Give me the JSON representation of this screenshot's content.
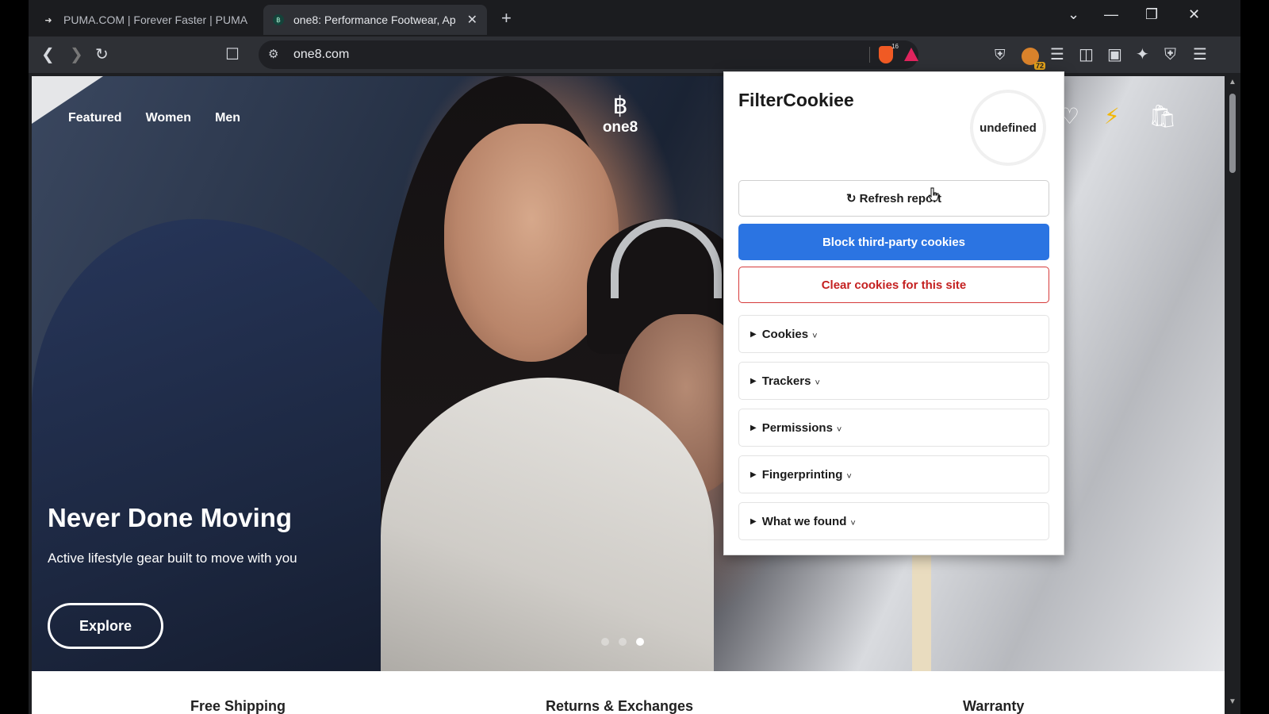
{
  "browser": {
    "tabs": [
      {
        "title": "PUMA.COM | Forever Faster | PUMA",
        "favicon": "puma-cat-icon",
        "active": false
      },
      {
        "title": "one8: Performance Footwear, Ap",
        "favicon": "one8-logo-icon",
        "active": true
      }
    ],
    "new_tab": "+",
    "url": "one8.com",
    "brave_shield_count": "16",
    "extension_badge": "72"
  },
  "site": {
    "nav": [
      "Featured",
      "Women",
      "Men"
    ],
    "logo_glyph": "฿",
    "logo_text": "one8",
    "hero_title": "Never Done Moving",
    "hero_subtitle": "Active lifestyle gear built to move with you",
    "cta": "Explore",
    "carousel_active": 3,
    "features": [
      "Free Shipping",
      "Returns & Exchanges",
      "Warranty"
    ]
  },
  "popup": {
    "title": "FilterCookiee",
    "score": "undefined",
    "refresh_label": "↻ Refresh report",
    "block_label": "Block third-party cookies",
    "clear_label": "Clear cookies for this site",
    "sections": [
      "Cookies",
      "Trackers",
      "Permissions",
      "Fingerprinting",
      "What we found"
    ],
    "chevron": "˅",
    "colors": {
      "primary": "#2b74e2",
      "danger": "#c42020"
    }
  }
}
